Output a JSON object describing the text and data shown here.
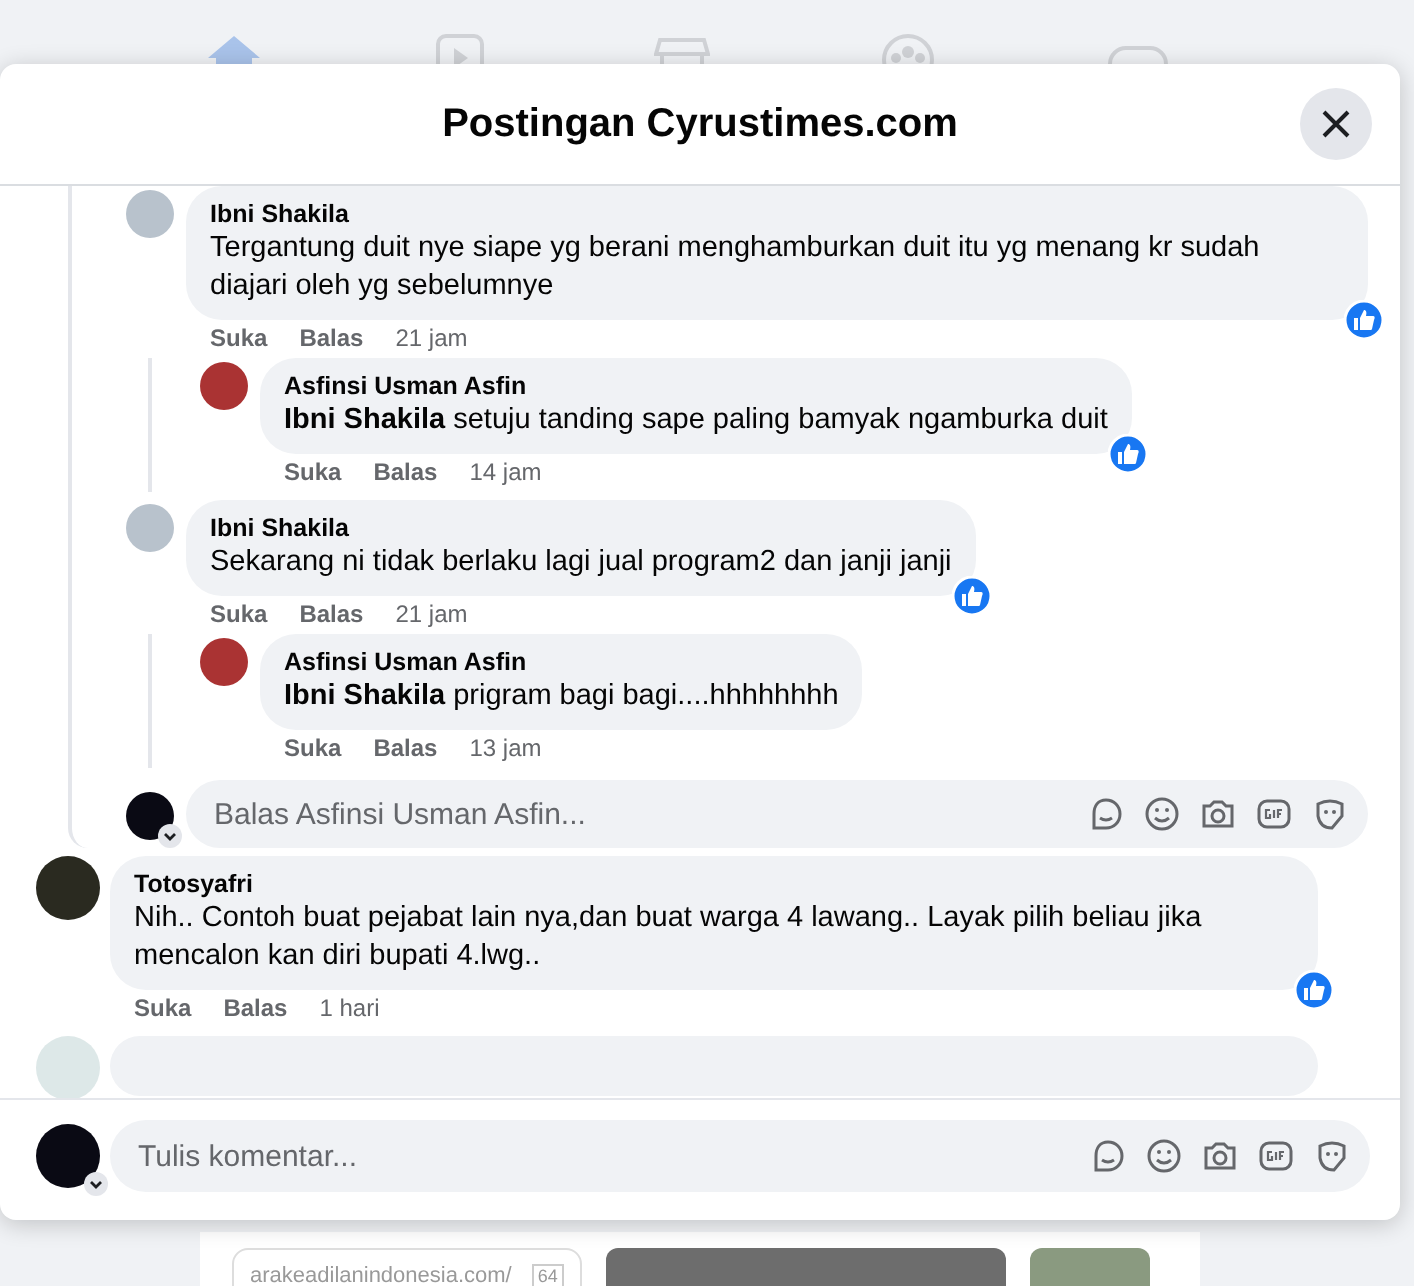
{
  "dialog": {
    "title": "Postingan Cyrustimes.com"
  },
  "thread": {
    "replies": [
      {
        "author": "Ibni Shakila",
        "text": "Tergantung duit nye siape yg berani menghamburkan duit itu yg menang kr sudah diajari oleh yg sebelumnye",
        "like_label": "Suka",
        "reply_label": "Balas",
        "time": "21 jam",
        "liked": true,
        "children": [
          {
            "author": "Asfinsi Usman Asfin",
            "text": "**Ibni Shakila** setuju tanding sape paling bamyak ngamburka duit",
            "like_label": "Suka",
            "reply_label": "Balas",
            "time": "14 jam",
            "liked": true
          }
        ]
      },
      {
        "author": "Ibni Shakila",
        "text": "Sekarang ni tidak berlaku lagi jual program2 dan janji janji",
        "like_label": "Suka",
        "reply_label": "Balas",
        "time": "21 jam",
        "liked": true,
        "children": [
          {
            "author": "Asfinsi Usman Asfin",
            "text": "**Ibni Shakila** prigram bagi bagi....hhhhhhhh",
            "like_label": "Suka",
            "reply_label": "Balas",
            "time": "13 jam",
            "liked": false
          }
        ]
      }
    ],
    "reply_field": {
      "placeholder": "Balas Asfinsi Usman Asfin..."
    }
  },
  "comments": [
    {
      "author": "Totosyafri",
      "text": "Nih.. Contoh buat pejabat lain nya,dan buat warga 4 lawang.. Layak pilih beliau jika mencalon kan diri bupati 4.lwg..",
      "like_label": "Suka",
      "reply_label": "Balas",
      "time": "1 hari",
      "liked": true
    }
  ],
  "comment_field": {
    "placeholder": "Tulis komentar..."
  },
  "background_post": {
    "link": "arakeadilanindonesia.com/",
    "count": "64"
  }
}
